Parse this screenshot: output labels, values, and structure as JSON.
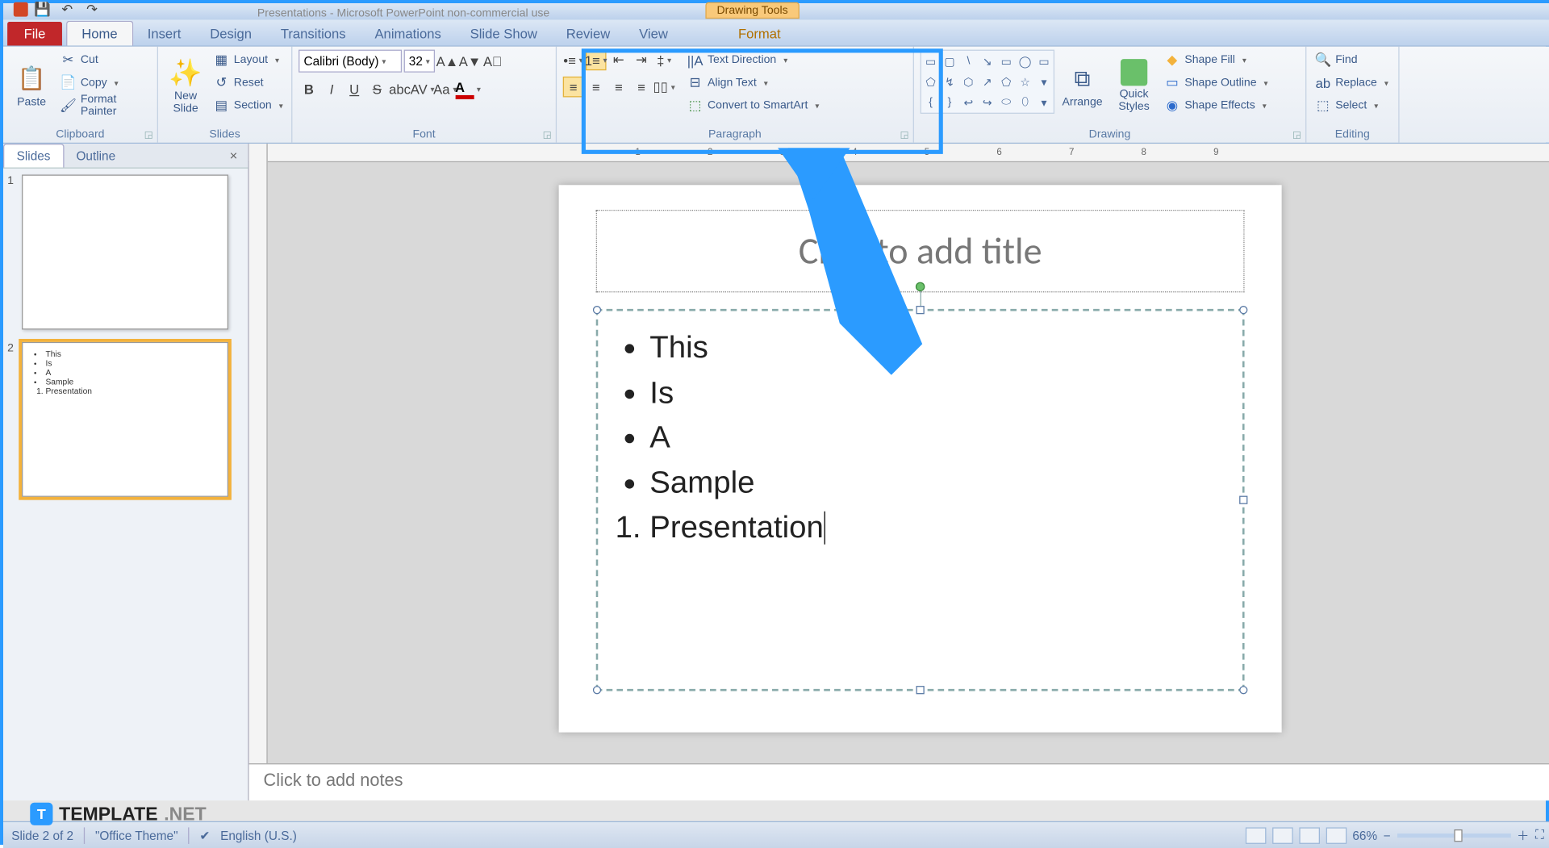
{
  "window": {
    "title": "Presentations - Microsoft PowerPoint non-commercial use"
  },
  "context_tab": {
    "group": "Drawing Tools",
    "tab": "Format"
  },
  "tabs": {
    "file": "File",
    "home": "Home",
    "insert": "Insert",
    "design": "Design",
    "transitions": "Transitions",
    "animations": "Animations",
    "slideshow": "Slide Show",
    "review": "Review",
    "view": "View",
    "format": "Format"
  },
  "ribbon": {
    "clipboard": {
      "label": "Clipboard",
      "paste": "Paste",
      "cut": "Cut",
      "copy": "Copy",
      "format_painter": "Format Painter"
    },
    "slides": {
      "label": "Slides",
      "new_slide": "New\nSlide",
      "layout": "Layout",
      "reset": "Reset",
      "section": "Section"
    },
    "font": {
      "label": "Font",
      "name": "Calibri (Body)",
      "size": "32"
    },
    "paragraph": {
      "label": "Paragraph",
      "text_direction": "Text Direction",
      "align_text": "Align Text",
      "convert_smartart": "Convert to SmartArt"
    },
    "drawing": {
      "label": "Drawing",
      "arrange": "Arrange",
      "quick_styles": "Quick\nStyles",
      "shape_fill": "Shape Fill",
      "shape_outline": "Shape Outline",
      "shape_effects": "Shape Effects"
    },
    "editing": {
      "label": "Editing",
      "find": "Find",
      "replace": "Replace",
      "select": "Select"
    }
  },
  "panel": {
    "slides_tab": "Slides",
    "outline_tab": "Outline"
  },
  "thumb2": {
    "b1": "This",
    "b2": "Is",
    "b3": "A",
    "b4": "Sample",
    "n1": "Presentation"
  },
  "slide": {
    "title_placeholder": "Click to add title",
    "bullets": [
      "This",
      "Is",
      "A",
      "Sample"
    ],
    "numbered": [
      "Presentation"
    ]
  },
  "notes_placeholder": "Click to add notes",
  "statusbar": {
    "slide_info": "Slide 2 of 2",
    "theme": "\"Office Theme\"",
    "lang": "English (U.S.)",
    "zoom": "66%"
  },
  "watermark": {
    "brand": "TEMPLATE",
    "suffix": ".NET"
  }
}
